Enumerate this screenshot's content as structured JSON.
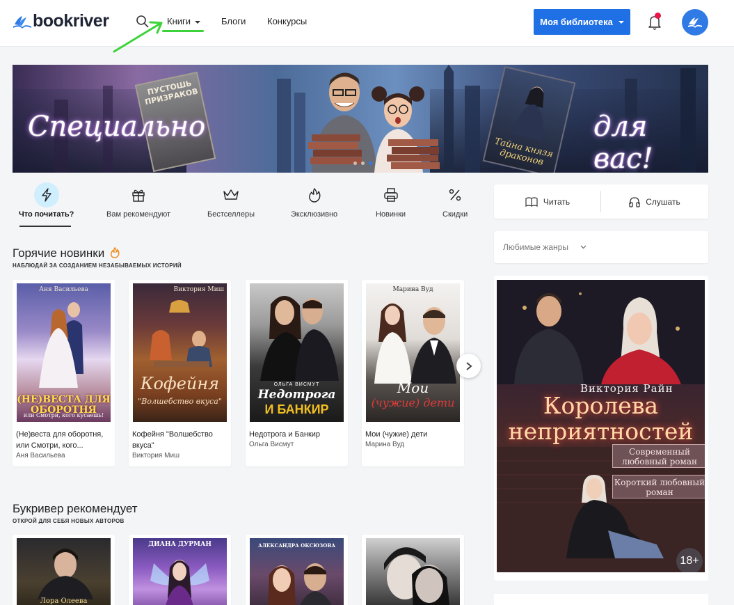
{
  "header": {
    "logo": "bookriver",
    "nav": {
      "books": "Книги",
      "blogs": "Блоги",
      "contests": "Конкурсы"
    },
    "library_button": "Моя библиотека"
  },
  "banner": {
    "left_text": "Специально",
    "right_text": "для вас!",
    "book1_title": "ПУСТОШЬ ПРИЗРАКОВ",
    "book2_title": "Тайна князя драконов"
  },
  "categories": [
    {
      "label": "Что почитать?",
      "icon": "lightning-icon"
    },
    {
      "label": "Вам рекомендуют",
      "icon": "gift-icon"
    },
    {
      "label": "Бестселлеры",
      "icon": "crown-icon"
    },
    {
      "label": "Эксклюзивно",
      "icon": "flame-icon"
    },
    {
      "label": "Новинки",
      "icon": "printer-icon"
    },
    {
      "label": "Скидки",
      "icon": "percent-icon"
    }
  ],
  "side": {
    "read": "Читать",
    "listen": "Слушать",
    "genres": "Любимые жанры",
    "ad": {
      "author": "Виктория Райн",
      "title_line1": "Королева",
      "title_line2": "неприятностей",
      "tag1": "Современный любовный роман",
      "tag2": "Короткий любовный роман",
      "age": "18+"
    }
  },
  "hot": {
    "title": "Горячие новинки",
    "subtitle": "НАБЛЮДАЙ ЗА СОЗДАНИЕМ НЕЗАБЫВАЕМЫХ ИСТОРИЙ",
    "books": [
      {
        "title": "(Не)веста для оборотня, или Смотри, кого...",
        "author": "Аня Васильева",
        "cover_name": "Аня Васильева",
        "cover_title": "(НЕ)ВЕСТА ДЛЯ ОБОРОТНЯ",
        "cover_sub": "или Смотри, кого кусаешь!"
      },
      {
        "title": "Кофейня \"Волшебство вкуса\"",
        "author": "Виктория Миш",
        "cover_name": "Виктория Миш",
        "cover_title": "Кофейня",
        "cover_sub": "\"Волшебство вкуса\""
      },
      {
        "title": "Недотрога и Банкир",
        "author": "Ольга Висмут",
        "cover_name": "ОЛЬГА ВИСМУТ",
        "cover_title": "Недотрога",
        "cover_sub": "И БАНКИР"
      },
      {
        "title": "Мои (чужие) дети",
        "author": "Марина Вуд",
        "cover_name": "Марина Вуд",
        "cover_title": "Мои",
        "cover_sub": "(чужие) дети"
      }
    ]
  },
  "recommend": {
    "title": "Букривер рекомендует",
    "subtitle": "ОТКРОЙ ДЛЯ СЕБЯ НОВЫХ АВТОРОВ",
    "books": [
      {
        "cover_name": "Лора Олеева"
      },
      {
        "cover_name": "ДИАНА ДУРМАН"
      },
      {
        "cover_name": "АЛЕКСАНДРА ОКСЮЗОВА"
      },
      {
        "cover_name": ""
      }
    ]
  },
  "colors": {
    "accent": "#1f6fe5",
    "notification": "#e8184a",
    "highlight": "#3cd33a"
  }
}
